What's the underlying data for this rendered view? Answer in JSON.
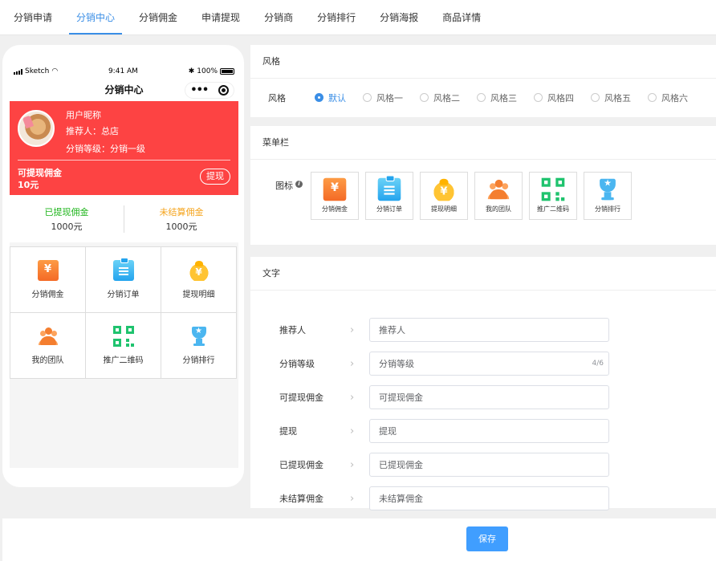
{
  "tabs": [
    {
      "label": "分销申请"
    },
    {
      "label": "分销中心",
      "active": true
    },
    {
      "label": "分销佣金"
    },
    {
      "label": "申请提现"
    },
    {
      "label": "分销商"
    },
    {
      "label": "分销排行"
    },
    {
      "label": "分销海报"
    },
    {
      "label": "商品详情"
    }
  ],
  "phone": {
    "status": {
      "carrier": "Sketch",
      "time": "9:41 AM",
      "battery": "100%"
    },
    "nav_title": "分销中心",
    "capsule_dots": "•••",
    "user": {
      "nickname": "用户昵称",
      "referrer": "推荐人：总店",
      "level": "分销等级：分销一级"
    },
    "available": {
      "label": "可提现佣金",
      "value": "10元",
      "button": "提现"
    },
    "stats": [
      {
        "label": "已提现佣金",
        "value": "1000元"
      },
      {
        "label": "未结算佣金",
        "value": "1000元"
      }
    ],
    "grid": [
      {
        "label": "分销佣金",
        "icon": "commission-icon"
      },
      {
        "label": "分销订单",
        "icon": "order-icon"
      },
      {
        "label": "提现明细",
        "icon": "money-bag-icon"
      },
      {
        "label": "我的团队",
        "icon": "team-icon"
      },
      {
        "label": "推广二维码",
        "icon": "qr-code-icon"
      },
      {
        "label": "分销排行",
        "icon": "trophy-icon"
      }
    ]
  },
  "style_panel": {
    "title": "风格",
    "row_label": "风格",
    "options": [
      "默认",
      "风格一",
      "风格二",
      "风格三",
      "风格四",
      "风格五",
      "风格六"
    ],
    "selected": "默认"
  },
  "menu_panel": {
    "title": "菜单栏",
    "row_label": "图标",
    "items": [
      {
        "label": "分销佣金",
        "icon": "commission-icon"
      },
      {
        "label": "分销订单",
        "icon": "order-icon"
      },
      {
        "label": "提现明细",
        "icon": "money-bag-icon"
      },
      {
        "label": "我的团队",
        "icon": "team-icon"
      },
      {
        "label": "推广二维码",
        "icon": "qr-code-icon"
      },
      {
        "label": "分销排行",
        "icon": "trophy-icon"
      }
    ]
  },
  "text_panel": {
    "title": "文字",
    "rows": [
      {
        "label": "推荐人",
        "value": "推荐人"
      },
      {
        "label": "分销等级",
        "value": "分销等级",
        "count": "4/6"
      },
      {
        "label": "可提现佣金",
        "value": "可提现佣金"
      },
      {
        "label": "提现",
        "value": "提现"
      },
      {
        "label": "已提现佣金",
        "value": "已提现佣金"
      },
      {
        "label": "未结算佣金",
        "value": "未结算佣金"
      }
    ]
  },
  "footer": {
    "save_label": "保存"
  },
  "colors": {
    "accent": "#409eff",
    "header_red": "#fd4343",
    "green": "#1fb51c",
    "orange": "#f5a31a"
  }
}
